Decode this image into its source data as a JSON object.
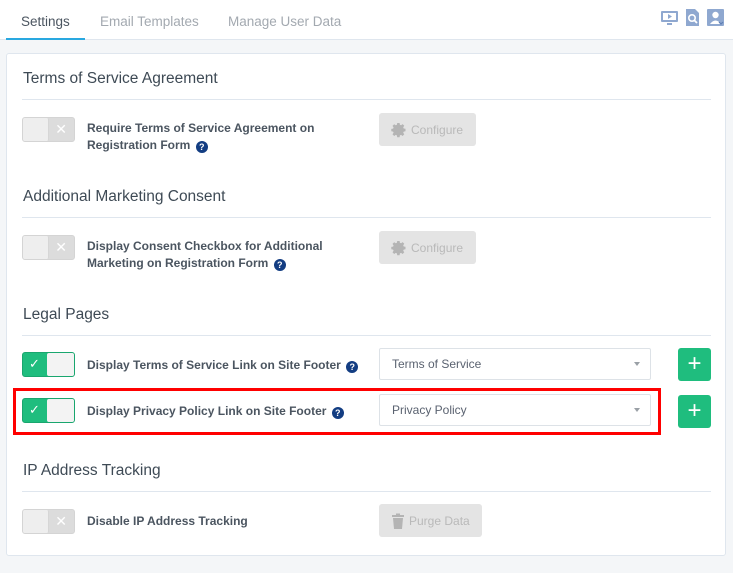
{
  "tabs": [
    {
      "label": "Settings",
      "active": true
    },
    {
      "label": "Email Templates",
      "active": false
    },
    {
      "label": "Manage User Data",
      "active": false
    }
  ],
  "top_icons": [
    "video-tutorial-icon",
    "search-document-icon",
    "user-profile-icon"
  ],
  "sections": {
    "tos": {
      "title": "Terms of Service Agreement",
      "row": {
        "label_line1": "Require Terms of Service Agreement on",
        "label_line2": "Registration Form",
        "enabled": false,
        "button": "Configure"
      }
    },
    "marketing": {
      "title": "Additional Marketing Consent",
      "row": {
        "label_line1": "Display Consent Checkbox for Additional",
        "label_line2": "Marketing on Registration Form",
        "enabled": false,
        "button": "Configure"
      }
    },
    "legal": {
      "title": "Legal Pages",
      "rows": [
        {
          "label": "Display Terms of Service Link on Site Footer",
          "enabled": true,
          "select_value": "Terms of Service"
        },
        {
          "label": "Display Privacy Policy Link on Site Footer",
          "enabled": true,
          "select_value": "Privacy Policy"
        }
      ]
    },
    "ip": {
      "title": "IP Address Tracking",
      "row": {
        "label": "Disable IP Address Tracking",
        "enabled": false,
        "button": "Purge Data"
      }
    }
  },
  "glyphs": {
    "help": "?",
    "off": "✕",
    "on": "✓",
    "add": "+"
  },
  "colors": {
    "accent": "#29a8e0",
    "success": "#1fbd7e",
    "help": "#133d82",
    "highlight": "#ff0000"
  }
}
